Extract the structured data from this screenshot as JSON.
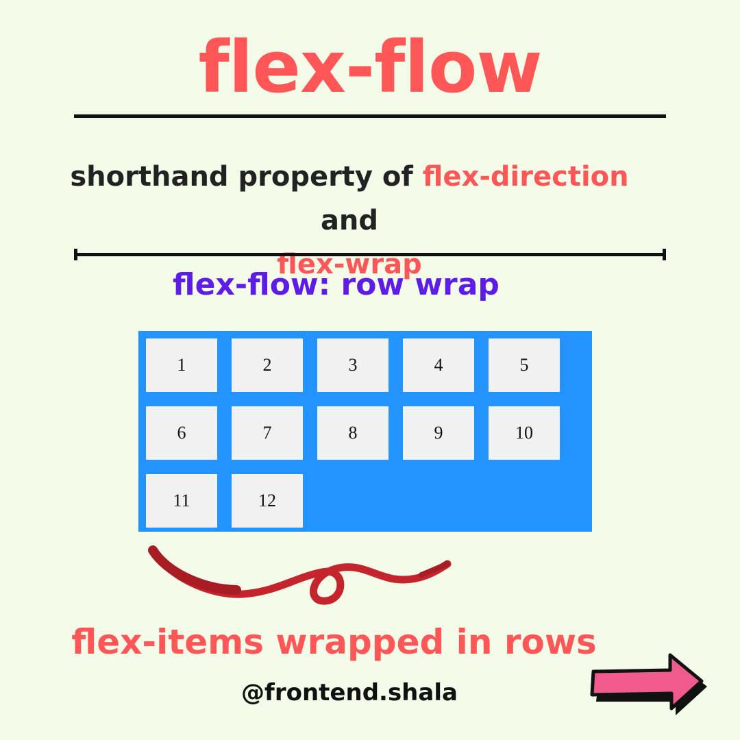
{
  "title": "flex-flow",
  "description": {
    "part1": "shorthand property  of ",
    "highlight1": "flex-direction",
    "part2": " and",
    "highlight2": "flex-wrap"
  },
  "subtitle": "flex-flow: row wrap",
  "flex_items": [
    "1",
    "2",
    "3",
    "4",
    "5",
    "6",
    "7",
    "8",
    "9",
    "10",
    "11",
    "12"
  ],
  "caption": "flex-items wrapped in rows",
  "handle": "@frontend.shala",
  "colors": {
    "background": "#f4fbe9",
    "accent": "#ff5757",
    "subtitle": "#5d1de6",
    "container": "#2394ff",
    "item": "#f1f1f1",
    "ribbon": "#c4242c",
    "arrow": "#f15a8c"
  },
  "icons": {
    "ribbon": "ribbon-swirl-icon",
    "arrow": "arrow-right-icon"
  }
}
